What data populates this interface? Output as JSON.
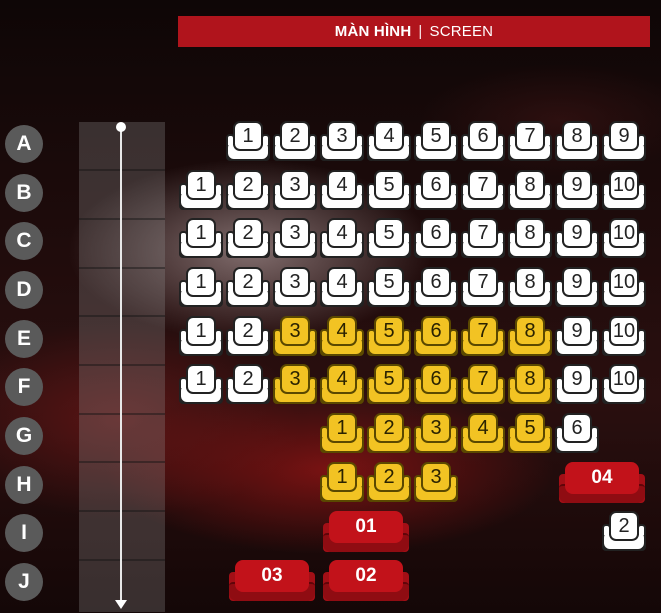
{
  "screen": {
    "label_vi": "MÀN HÌNH",
    "separator": "|",
    "label_en": "SCREEN"
  },
  "row_labels": [
    "A",
    "B",
    "C",
    "D",
    "E",
    "F",
    "G",
    "H",
    "I",
    "J"
  ],
  "colors": {
    "available": "#ffffff",
    "selected": "#f2c323",
    "couple": "#c2121a",
    "screen_banner": "#b0141c"
  },
  "seats": {
    "A": [
      "1",
      "2",
      "3",
      "4",
      "5",
      "6",
      "7",
      "8",
      "9"
    ],
    "B": [
      "1",
      "2",
      "3",
      "4",
      "5",
      "6",
      "7",
      "8",
      "9",
      "10"
    ],
    "C": [
      "1",
      "2",
      "3",
      "4",
      "5",
      "6",
      "7",
      "8",
      "9",
      "10"
    ],
    "D": [
      "1",
      "2",
      "3",
      "4",
      "5",
      "6",
      "7",
      "8",
      "9",
      "10"
    ],
    "E": [
      "1",
      "2",
      "3",
      "4",
      "5",
      "6",
      "7",
      "8",
      "9",
      "10"
    ],
    "F": [
      "1",
      "2",
      "3",
      "4",
      "5",
      "6",
      "7",
      "8",
      "9",
      "10"
    ],
    "G": [
      "1",
      "2",
      "3",
      "4",
      "5",
      "6"
    ],
    "H": [
      "1",
      "2",
      "3"
    ],
    "I": [
      "2"
    ]
  },
  "couple_seats": {
    "h4": "04",
    "i1": "01",
    "j3": "03",
    "j2": "02"
  }
}
